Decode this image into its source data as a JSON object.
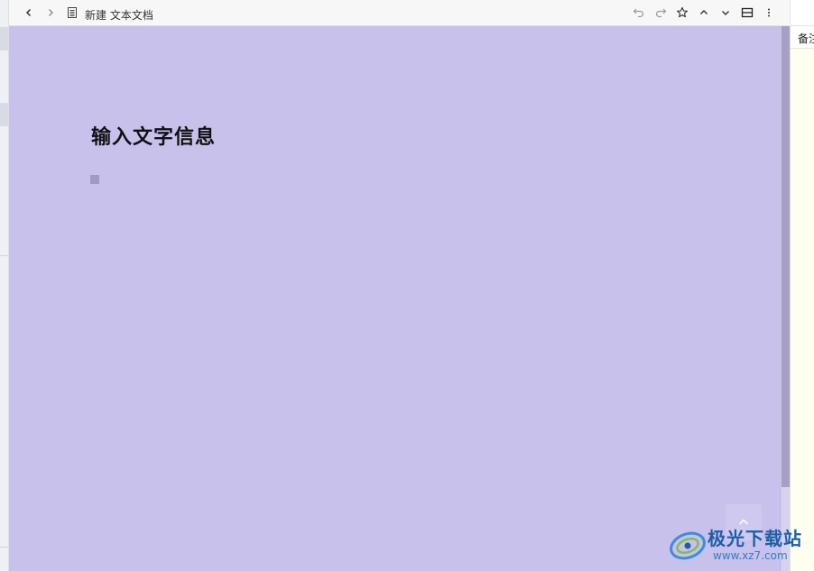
{
  "toolbar": {
    "back_icon": "chevron-left-icon",
    "forward_icon": "chevron-right-icon",
    "doc_icon": "document-icon",
    "doc_title": "新建 文本文档",
    "undo_icon": "undo-icon",
    "redo_icon": "redo-icon",
    "star_icon": "star-icon",
    "up_icon": "chevron-up-icon",
    "down_icon": "chevron-down-icon",
    "layout_icon": "split-layout-icon",
    "more_icon": "more-vertical-icon"
  },
  "document": {
    "heading": "输入文字信息",
    "background_color": "#c8c1ec"
  },
  "right_panel": {
    "tab_label": "备注"
  },
  "watermark": {
    "name": "极光下载站",
    "url": "www.xz7.com"
  },
  "colors": {
    "accent": "#1b5fa7",
    "doc_background": "#c8c1ec",
    "notes_background": "#fffff0"
  }
}
